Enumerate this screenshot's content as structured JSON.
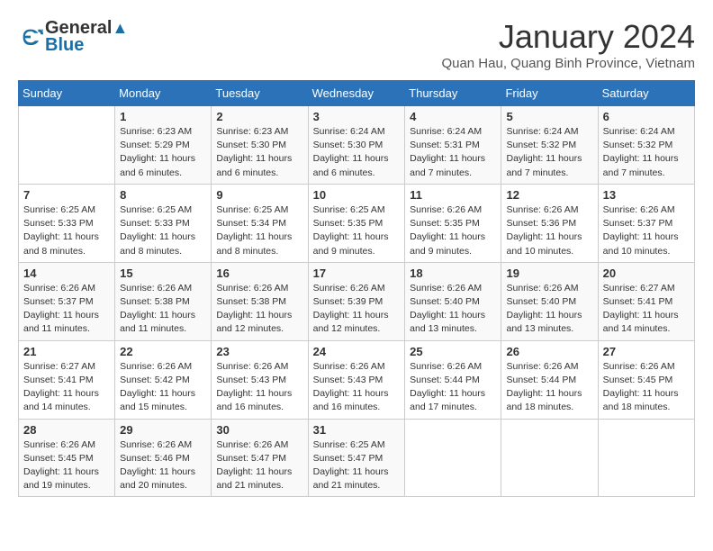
{
  "header": {
    "logo_line1": "General",
    "logo_line2": "Blue",
    "month_title": "January 2024",
    "subtitle": "Quan Hau, Quang Binh Province, Vietnam"
  },
  "days_of_week": [
    "Sunday",
    "Monday",
    "Tuesday",
    "Wednesday",
    "Thursday",
    "Friday",
    "Saturday"
  ],
  "weeks": [
    [
      {
        "day": "",
        "info": ""
      },
      {
        "day": "1",
        "info": "Sunrise: 6:23 AM\nSunset: 5:29 PM\nDaylight: 11 hours\nand 6 minutes."
      },
      {
        "day": "2",
        "info": "Sunrise: 6:23 AM\nSunset: 5:30 PM\nDaylight: 11 hours\nand 6 minutes."
      },
      {
        "day": "3",
        "info": "Sunrise: 6:24 AM\nSunset: 5:30 PM\nDaylight: 11 hours\nand 6 minutes."
      },
      {
        "day": "4",
        "info": "Sunrise: 6:24 AM\nSunset: 5:31 PM\nDaylight: 11 hours\nand 7 minutes."
      },
      {
        "day": "5",
        "info": "Sunrise: 6:24 AM\nSunset: 5:32 PM\nDaylight: 11 hours\nand 7 minutes."
      },
      {
        "day": "6",
        "info": "Sunrise: 6:24 AM\nSunset: 5:32 PM\nDaylight: 11 hours\nand 7 minutes."
      }
    ],
    [
      {
        "day": "7",
        "info": "Sunrise: 6:25 AM\nSunset: 5:33 PM\nDaylight: 11 hours\nand 8 minutes."
      },
      {
        "day": "8",
        "info": "Sunrise: 6:25 AM\nSunset: 5:33 PM\nDaylight: 11 hours\nand 8 minutes."
      },
      {
        "day": "9",
        "info": "Sunrise: 6:25 AM\nSunset: 5:34 PM\nDaylight: 11 hours\nand 8 minutes."
      },
      {
        "day": "10",
        "info": "Sunrise: 6:25 AM\nSunset: 5:35 PM\nDaylight: 11 hours\nand 9 minutes."
      },
      {
        "day": "11",
        "info": "Sunrise: 6:26 AM\nSunset: 5:35 PM\nDaylight: 11 hours\nand 9 minutes."
      },
      {
        "day": "12",
        "info": "Sunrise: 6:26 AM\nSunset: 5:36 PM\nDaylight: 11 hours\nand 10 minutes."
      },
      {
        "day": "13",
        "info": "Sunrise: 6:26 AM\nSunset: 5:37 PM\nDaylight: 11 hours\nand 10 minutes."
      }
    ],
    [
      {
        "day": "14",
        "info": "Sunrise: 6:26 AM\nSunset: 5:37 PM\nDaylight: 11 hours\nand 11 minutes."
      },
      {
        "day": "15",
        "info": "Sunrise: 6:26 AM\nSunset: 5:38 PM\nDaylight: 11 hours\nand 11 minutes."
      },
      {
        "day": "16",
        "info": "Sunrise: 6:26 AM\nSunset: 5:38 PM\nDaylight: 11 hours\nand 12 minutes."
      },
      {
        "day": "17",
        "info": "Sunrise: 6:26 AM\nSunset: 5:39 PM\nDaylight: 11 hours\nand 12 minutes."
      },
      {
        "day": "18",
        "info": "Sunrise: 6:26 AM\nSunset: 5:40 PM\nDaylight: 11 hours\nand 13 minutes."
      },
      {
        "day": "19",
        "info": "Sunrise: 6:26 AM\nSunset: 5:40 PM\nDaylight: 11 hours\nand 13 minutes."
      },
      {
        "day": "20",
        "info": "Sunrise: 6:27 AM\nSunset: 5:41 PM\nDaylight: 11 hours\nand 14 minutes."
      }
    ],
    [
      {
        "day": "21",
        "info": "Sunrise: 6:27 AM\nSunset: 5:41 PM\nDaylight: 11 hours\nand 14 minutes."
      },
      {
        "day": "22",
        "info": "Sunrise: 6:26 AM\nSunset: 5:42 PM\nDaylight: 11 hours\nand 15 minutes."
      },
      {
        "day": "23",
        "info": "Sunrise: 6:26 AM\nSunset: 5:43 PM\nDaylight: 11 hours\nand 16 minutes."
      },
      {
        "day": "24",
        "info": "Sunrise: 6:26 AM\nSunset: 5:43 PM\nDaylight: 11 hours\nand 16 minutes."
      },
      {
        "day": "25",
        "info": "Sunrise: 6:26 AM\nSunset: 5:44 PM\nDaylight: 11 hours\nand 17 minutes."
      },
      {
        "day": "26",
        "info": "Sunrise: 6:26 AM\nSunset: 5:44 PM\nDaylight: 11 hours\nand 18 minutes."
      },
      {
        "day": "27",
        "info": "Sunrise: 6:26 AM\nSunset: 5:45 PM\nDaylight: 11 hours\nand 18 minutes."
      }
    ],
    [
      {
        "day": "28",
        "info": "Sunrise: 6:26 AM\nSunset: 5:45 PM\nDaylight: 11 hours\nand 19 minutes."
      },
      {
        "day": "29",
        "info": "Sunrise: 6:26 AM\nSunset: 5:46 PM\nDaylight: 11 hours\nand 20 minutes."
      },
      {
        "day": "30",
        "info": "Sunrise: 6:26 AM\nSunset: 5:47 PM\nDaylight: 11 hours\nand 21 minutes."
      },
      {
        "day": "31",
        "info": "Sunrise: 6:25 AM\nSunset: 5:47 PM\nDaylight: 11 hours\nand 21 minutes."
      },
      {
        "day": "",
        "info": ""
      },
      {
        "day": "",
        "info": ""
      },
      {
        "day": "",
        "info": ""
      }
    ]
  ]
}
